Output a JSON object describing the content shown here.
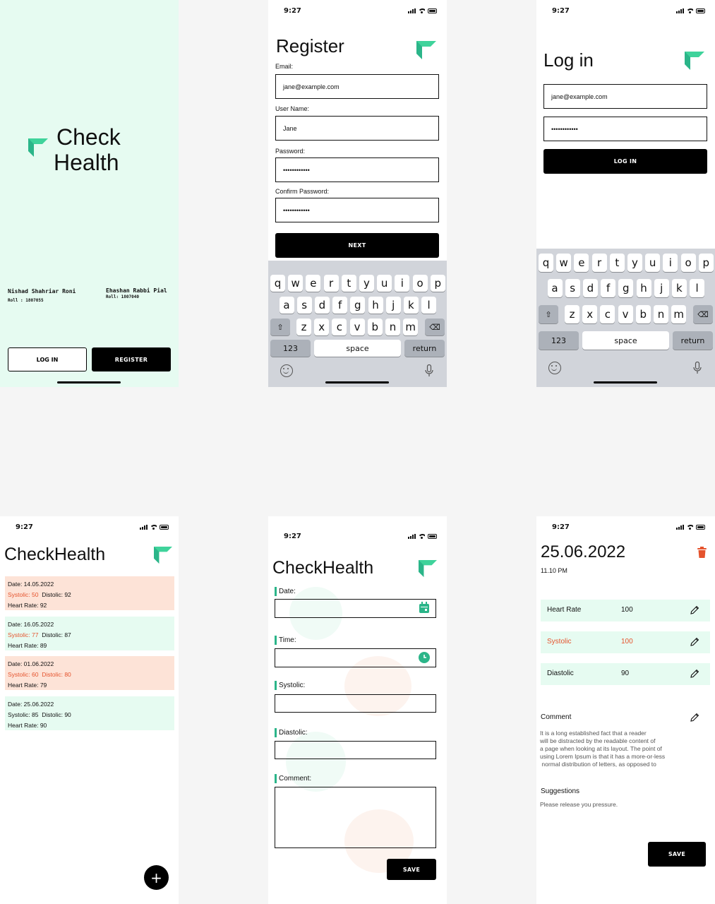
{
  "status": {
    "time": "9:27"
  },
  "splash": {
    "logo_line1": "Check",
    "logo_line2": "Health",
    "author1_name": "Nishad Shahriar Roni",
    "author1_roll": "Roll : 1807055",
    "author2_name": "Ehashan Rabbi Pial",
    "author2_roll": "Roll: 1807040",
    "login_label": "LOG IN",
    "register_label": "REGISTER"
  },
  "register": {
    "title": "Register",
    "email_label": "Email:",
    "email_value": "jane@example.com",
    "username_label": "User Name:",
    "username_value": "Jane",
    "password_label": "Password:",
    "password_value": "••••••••••••",
    "confirm_label": "Confirm Password:",
    "confirm_value": "••••••••••••",
    "next_label": "NEXT"
  },
  "login": {
    "title": "Log in",
    "email_value": "jane@example.com",
    "password_value": "••••••••••••",
    "login_label": "LOG IN"
  },
  "keyboard": {
    "row1": [
      "q",
      "w",
      "e",
      "r",
      "t",
      "y",
      "u",
      "i",
      "o",
      "p"
    ],
    "row2": [
      "a",
      "s",
      "d",
      "f",
      "g",
      "h",
      "j",
      "k",
      "l"
    ],
    "row3": [
      "z",
      "x",
      "c",
      "v",
      "b",
      "n",
      "m"
    ],
    "numbers": "123",
    "space": "space",
    "return": "return"
  },
  "list": {
    "title": "CheckHealth",
    "records": [
      {
        "date": "Date: 14.05.2022",
        "systolic": "Systolic: 50",
        "diastolic": "Distolic: 92",
        "heart": "Heart Rate: 92"
      },
      {
        "date": "Date: 16.05.2022",
        "systolic": "Systolic: 77",
        "diastolic": "Distolic: 87",
        "heart": "Heart Rate: 89"
      },
      {
        "date": "Date: 01.06.2022",
        "systolic": "Systolic: 60",
        "diastolic": "Distolic: 80",
        "heart": "Heart Rate: 79"
      },
      {
        "date": "Date: 25.06.2022",
        "systolic": "Systolic: 85",
        "diastolic": "Distolic: 90",
        "heart": "Heart Rate: 90"
      }
    ],
    "add_label": "+"
  },
  "form": {
    "title": "CheckHealth",
    "date_label": "Date:",
    "time_label": "Time:",
    "systolic_label": "Systolic:",
    "diastolic_label": "Diastolic:",
    "comment_label": "Comment:",
    "save_label": "SAVE"
  },
  "detail": {
    "date": "25.06.2022",
    "time": "11.10 PM",
    "heart_label": "Heart Rate",
    "heart_value": "100",
    "systolic_label": "Systolic",
    "systolic_value": "100",
    "diastolic_label": "Diastolic",
    "diastolic_value": "90",
    "comment_label": "Comment",
    "comment_line1": "It is a long established fact that a reader",
    "comment_line2": "will be distracted by the readable content of",
    "comment_line3": "a page when looking at its layout. The point of",
    "comment_line4": "using Lorem Ipsum is that it has a more-or-less",
    "comment_line5": " normal distribution of letters, as opposed to",
    "suggestions_label": "Suggestions",
    "suggestions_text": "Please release you pressure.",
    "save_label": "SAVE"
  },
  "colors": {
    "accent": "#2bb589",
    "mint": "#e6fbf1",
    "peach": "#fde3d7",
    "alert": "#e5532d"
  }
}
